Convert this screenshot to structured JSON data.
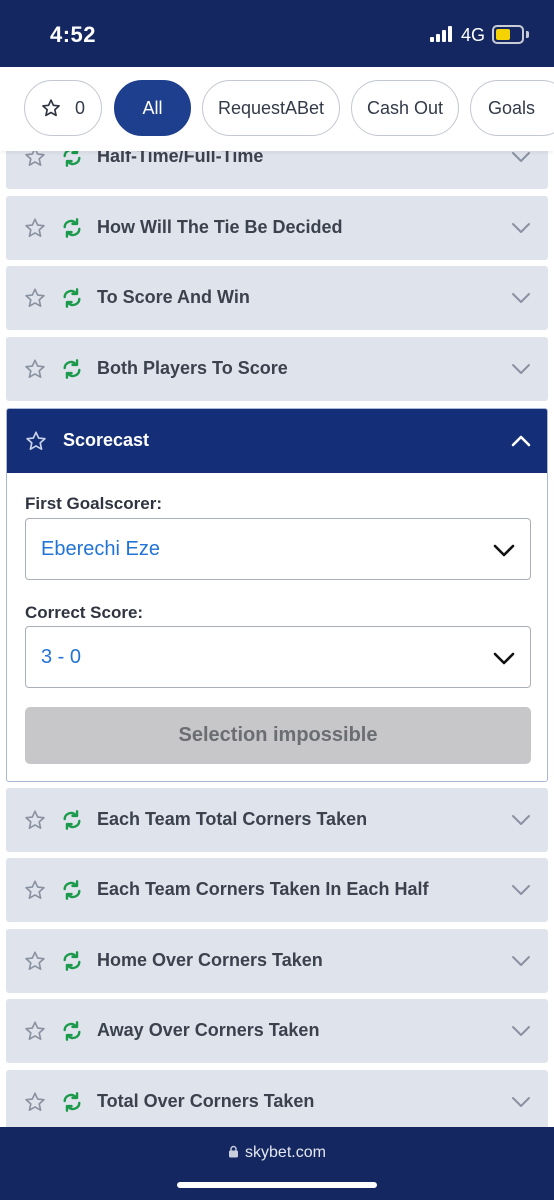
{
  "status_bar": {
    "time": "4:52",
    "network": "4G",
    "battery_level": 0.6
  },
  "filter_bar": {
    "favourites_count": "0",
    "pills": [
      "All",
      "RequestABet",
      "Cash Out",
      "Goals"
    ],
    "active": "All"
  },
  "markets_before": [
    {
      "title": "Half-Time/Full-Time"
    },
    {
      "title": "How Will The Tie Be Decided"
    },
    {
      "title": "To Score And Win"
    },
    {
      "title": "Both Players To Score"
    }
  ],
  "scorecast": {
    "title": "Scorecast",
    "first_goalscorer_label": "First Goalscorer:",
    "first_goalscorer_value": "Eberechi Eze",
    "correct_score_label": "Correct Score:",
    "correct_score_value": "3 - 0",
    "button_label": "Selection impossible"
  },
  "markets_after": [
    {
      "title": "Each Team Total Corners Taken"
    },
    {
      "title": "Each Team Corners Taken In Each Half"
    },
    {
      "title": "Home Over Corners Taken"
    },
    {
      "title": "Away Over Corners Taken"
    },
    {
      "title": "Total Over Corners Taken"
    }
  ],
  "browser": {
    "url": "skybet.com"
  },
  "colors": {
    "navy": "#142760",
    "header_blue": "#142f77",
    "pill_active": "#1e3f8e",
    "row_bg": "#dfe3ec",
    "link_blue": "#2274d6",
    "cashout_green": "#1a9a4a",
    "battery_yellow": "#f5d300"
  },
  "icons": [
    "star-icon",
    "cash-out-icon",
    "chevron-down-icon",
    "chevron-up-icon",
    "lock-icon"
  ]
}
